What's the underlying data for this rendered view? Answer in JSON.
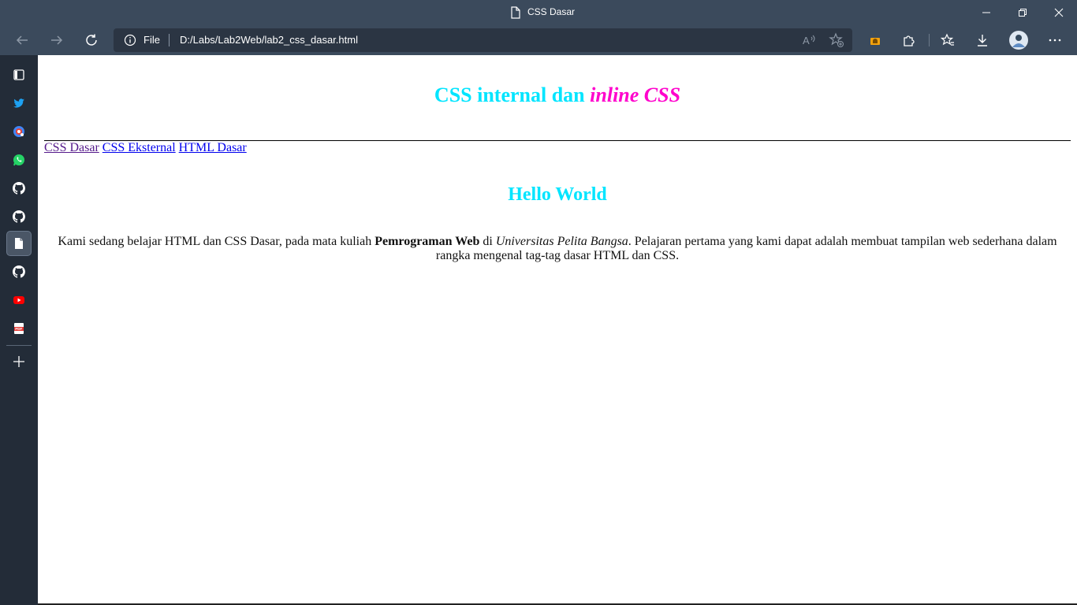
{
  "window": {
    "title": "CSS Dasar"
  },
  "address_bar": {
    "scheme_label": "File",
    "url": "D:/Labs/Lab2Web/lab2_css_dasar.html"
  },
  "colors": {
    "chrome_bg": "#3b4a5c",
    "address_bg": "#2b3543",
    "sidebar_bg": "#232c38",
    "heading_cyan": "#00e5ff",
    "heading_magenta": "#ff00cc",
    "link_blue": "#0000ee",
    "link_visited": "#551a8b"
  },
  "toolbar_icons": [
    "back-icon",
    "forward-icon",
    "refresh-icon",
    "info-icon",
    "read-aloud-icon",
    "add-favorite-icon",
    "extension-app-icon",
    "extensions-icon",
    "favorites-icon",
    "downloads-icon",
    "profile-avatar",
    "more-icon"
  ],
  "sidebar_icons": [
    "tab-actions-icon",
    "twitter-icon",
    "google-lens-icon",
    "whatsapp-icon",
    "github-icon",
    "github-icon",
    "document-icon",
    "github-icon",
    "youtube-icon",
    "pdf-icon",
    "add-icon"
  ],
  "page": {
    "heading_part1": "CSS internal dan ",
    "heading_part2": "inline CSS",
    "nav_links": [
      "CSS Dasar",
      "CSS Eksternal",
      "HTML Dasar"
    ],
    "hello": "Hello World",
    "paragraph": {
      "text1": "Kami sedang belajar HTML dan CSS Dasar, pada mata kuliah ",
      "bold": "Pemrograman Web",
      "text2": " di ",
      "italic": "Universitas Pelita Bangsa",
      "text3": ". Pelajaran pertama yang kami dapat adalah membuat tampilan web sederhana dalam rangka mengenal tag-tag dasar HTML dan CSS."
    }
  }
}
